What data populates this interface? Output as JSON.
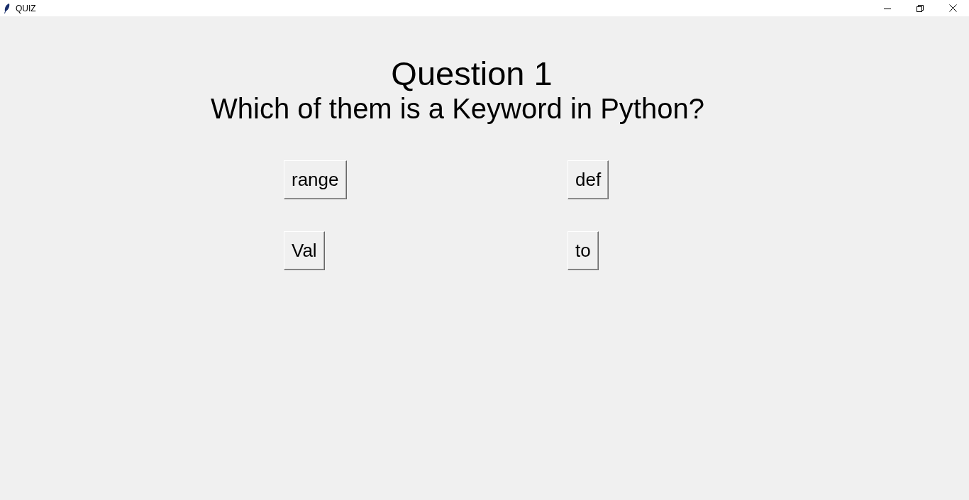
{
  "window": {
    "title": "QUIZ"
  },
  "question": {
    "heading": "Question 1",
    "text": "Which of them is a Keyword in Python?"
  },
  "options": [
    {
      "label": "range"
    },
    {
      "label": "def"
    },
    {
      "label": "Val"
    },
    {
      "label": "to"
    }
  ]
}
